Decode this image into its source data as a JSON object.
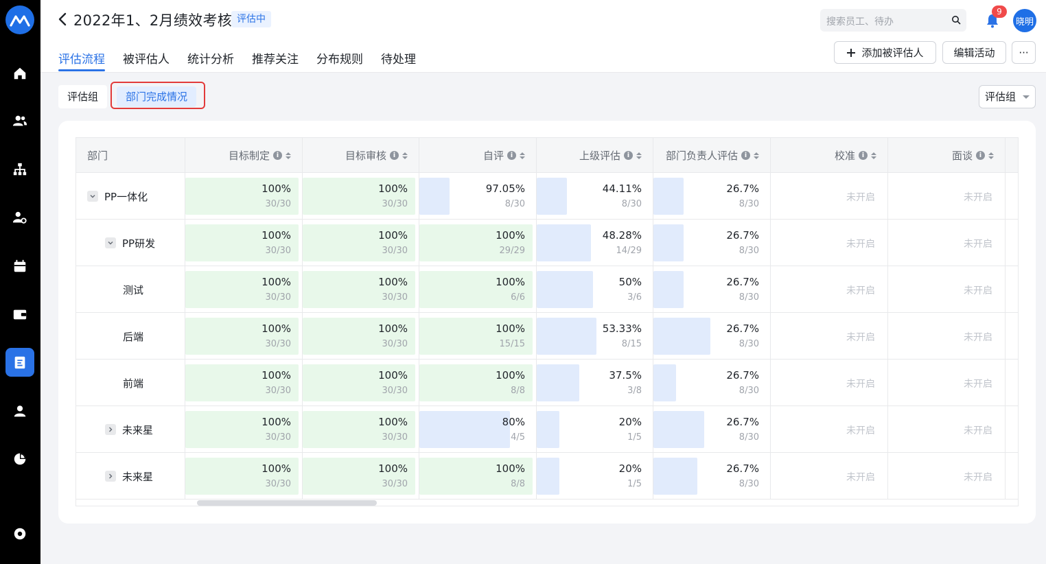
{
  "app": {
    "title": "2022年1、2月绩效考核",
    "status": "评估中",
    "search_placeholder": "搜索员工、待办",
    "notification_count": "9",
    "user_name": "晓明"
  },
  "tabs": [
    "评估流程",
    "被评估人",
    "统计分析",
    "推荐关注",
    "分布规则",
    "待处理"
  ],
  "active_tab": "评估流程",
  "actions": {
    "add_label": "添加被评估人",
    "edit_label": "编辑活动",
    "more_label": "···"
  },
  "segments": [
    "评估组",
    "部门完成情况"
  ],
  "active_segment": "部门完成情况",
  "group_select": "评估组",
  "columns": [
    "部门",
    "目标制定",
    "目标审核",
    "自评",
    "上级评估",
    "部门负责人评估",
    "校准",
    "面谈"
  ],
  "rows": [
    {
      "dept": "PP一体化",
      "toggle": "expanded",
      "cells": [
        {
          "pct": "100%",
          "frac": "30/30",
          "fill": 1.0
        },
        {
          "pct": "100%",
          "frac": "30/30",
          "fill": 1.0
        },
        {
          "pct": "97.05%",
          "frac": "8/30",
          "fill": 0.2667
        },
        {
          "pct": "44.11%",
          "frac": "8/30",
          "fill": 0.2667
        },
        {
          "pct": "26.7%",
          "frac": "8/30",
          "fill": 0.2667
        },
        {
          "na": "未开启"
        },
        {
          "na": "未开启"
        }
      ]
    },
    {
      "dept": "PP研发",
      "toggle": "expanded",
      "cells": [
        {
          "pct": "100%",
          "frac": "30/30",
          "fill": 1.0
        },
        {
          "pct": "100%",
          "frac": "30/30",
          "fill": 1.0
        },
        {
          "pct": "100%",
          "frac": "29/29",
          "fill": 1.0
        },
        {
          "pct": "48.28%",
          "frac": "14/29",
          "fill": 0.4828
        },
        {
          "pct": "26.7%",
          "frac": "8/30",
          "fill": 0.2667
        },
        {
          "na": "未开启"
        },
        {
          "na": "未开启"
        }
      ]
    },
    {
      "dept": "测试",
      "toggle": "none",
      "cells": [
        {
          "pct": "100%",
          "frac": "30/30",
          "fill": 1.0
        },
        {
          "pct": "100%",
          "frac": "30/30",
          "fill": 1.0
        },
        {
          "pct": "100%",
          "frac": "6/6",
          "fill": 1.0
        },
        {
          "pct": "50%",
          "frac": "3/6",
          "fill": 0.5
        },
        {
          "pct": "26.7%",
          "frac": "8/30",
          "fill": 0.2667
        },
        {
          "na": "未开启"
        },
        {
          "na": "未开启"
        }
      ]
    },
    {
      "dept": "后端",
      "toggle": "none",
      "cells": [
        {
          "pct": "100%",
          "frac": "30/30",
          "fill": 1.0
        },
        {
          "pct": "100%",
          "frac": "30/30",
          "fill": 1.0
        },
        {
          "pct": "100%",
          "frac": "15/15",
          "fill": 1.0
        },
        {
          "pct": "53.33%",
          "frac": "8/15",
          "fill": 0.5333
        },
        {
          "pct": "26.7%",
          "frac": "8/30",
          "fill": 0.5
        },
        {
          "na": "未开启"
        },
        {
          "na": "未开启"
        }
      ]
    },
    {
      "dept": "前端",
      "toggle": "none",
      "cells": [
        {
          "pct": "100%",
          "frac": "30/30",
          "fill": 1.0
        },
        {
          "pct": "100%",
          "frac": "30/30",
          "fill": 1.0
        },
        {
          "pct": "100%",
          "frac": "8/8",
          "fill": 1.0
        },
        {
          "pct": "37.5%",
          "frac": "3/8",
          "fill": 0.375
        },
        {
          "pct": "26.7%",
          "frac": "8/30",
          "fill": 0.2
        },
        {
          "na": "未开启"
        },
        {
          "na": "未开启"
        }
      ]
    },
    {
      "dept": "未来星",
      "toggle": "collapsed",
      "cells": [
        {
          "pct": "100%",
          "frac": "30/30",
          "fill": 1.0
        },
        {
          "pct": "100%",
          "frac": "30/30",
          "fill": 1.0
        },
        {
          "pct": "80%",
          "frac": "4/5",
          "fill": 0.8
        },
        {
          "pct": "20%",
          "frac": "1/5",
          "fill": 0.2
        },
        {
          "pct": "26.7%",
          "frac": "8/30",
          "fill": 0.45
        },
        {
          "na": "未开启"
        },
        {
          "na": "未开启"
        }
      ]
    },
    {
      "dept": "未来星",
      "toggle": "collapsed",
      "cells": [
        {
          "pct": "100%",
          "frac": "30/30",
          "fill": 1.0
        },
        {
          "pct": "100%",
          "frac": "30/30",
          "fill": 1.0
        },
        {
          "pct": "100%",
          "frac": "8/8",
          "fill": 1.0
        },
        {
          "pct": "20%",
          "frac": "1/5",
          "fill": 0.2
        },
        {
          "pct": "26.7%",
          "frac": "8/30",
          "fill": 0.39
        },
        {
          "na": "未开启"
        },
        {
          "na": "未开启"
        }
      ]
    }
  ],
  "colors": {
    "accent": "#2a72e6",
    "bar_green": "#e8f8ea",
    "bar_blue": "#e1ebfc",
    "highlight": "#e23a3a"
  }
}
